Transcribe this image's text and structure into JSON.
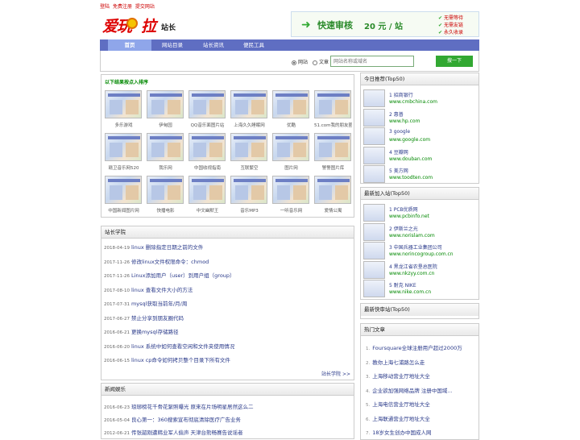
{
  "topbar": {
    "login": "登陆",
    "register": "免费注册",
    "submit": "提交网站"
  },
  "logo": {
    "main": "爱玩",
    "main2": "拉",
    "suffix": "站长"
  },
  "ad": {
    "title": "快速审核",
    "price": "20 元 / 站",
    "features": [
      "无需等待",
      "无需友链",
      "永久收录"
    ]
  },
  "nav": {
    "items": [
      "首页",
      "网站目录",
      "站长资讯",
      "便民工具"
    ]
  },
  "search": {
    "option1": "网站",
    "option2": "文章",
    "placeholder": "网站名称或域名",
    "button": "搜一下"
  },
  "sites": {
    "heading": "以下结果按点入排序",
    "items": [
      "多乐游戏",
      "伊甸园",
      "QQ音乐面图片站",
      "上海久久睡眠网",
      "优酷",
      "51.com我的朋友圈",
      "赣卫音乐网520",
      "我乐网",
      "中国收视指南",
      "互联繁空",
      "图片网",
      "警警图片库",
      "中国新闻图片网",
      "快播电影",
      "中文幽默王",
      "音乐MP3",
      "一听音乐网",
      "爱情公寓"
    ]
  },
  "academy": {
    "title": "站长学院",
    "more": "站长学院 >>",
    "articles": [
      {
        "date": "2018-04-19",
        "title": "linux 删除指定日期之前的文件"
      },
      {
        "date": "2017-11-26",
        "title": "修改linux文件权限命令：chmod"
      },
      {
        "date": "2017-11-26",
        "title": "Linux添加用户（user）到用户组（group）"
      },
      {
        "date": "2017-08-10",
        "title": "linux 查看文件大小的方法"
      },
      {
        "date": "2017-07-31",
        "title": "mysql获取当前年/月/周"
      },
      {
        "date": "2017-06-27",
        "title": "禁止分享到朋友圈代码"
      },
      {
        "date": "2016-06-21",
        "title": "更换mysql存储路径"
      },
      {
        "date": "2016-06-20",
        "title": "linux 系统中如何查看空闲和文件夹使用情况"
      },
      {
        "date": "2016-06-15",
        "title": "linux cp命令如何拷贝整个目录下所有文件"
      }
    ]
  },
  "news": {
    "title": "新闻娱乐",
    "articles": [
      {
        "date": "2016-06-23",
        "title": "琅琊榜花千骨花絮照曝光 原来在片场明星居然这么二"
      },
      {
        "date": "2016-05-04",
        "title": "良心第一：360搜索宣布彻底清除医疗广告业务"
      },
      {
        "date": "2012-06-21",
        "title": "传张韶刚遭韩业军人偷声 天津台熊畅赛告说谣者"
      }
    ]
  },
  "today": {
    "title": "今日推荐(Top50)",
    "items": [
      {
        "name": "1 招商银行",
        "url": "www.cmbchina.com"
      },
      {
        "name": "2 惠普",
        "url": "www.hp.com"
      },
      {
        "name": "3 google",
        "url": "www.google.com"
      },
      {
        "name": "4 豆瓣网",
        "url": "www.douban.com"
      },
      {
        "name": "5 美方网",
        "url": "www.toodten.com"
      }
    ]
  },
  "latest": {
    "title": "最新加入站(Top50)",
    "items": [
      {
        "name": "1 PCB优质网",
        "url": "www.pcbinfo.net"
      },
      {
        "name": "2 伊斯兰之光",
        "url": "www.norislam.com"
      },
      {
        "name": "3 中国兵器工业集团公司",
        "url": "www.norincogroup.com.cn"
      },
      {
        "name": "4 黑龙江省农垦总医院",
        "url": "www.nkzyy.com.cn"
      },
      {
        "name": "5 耐克 NIKE",
        "url": "www.nike.com.cn"
      }
    ]
  },
  "fast": {
    "title": "最新快审站(Top50)"
  },
  "hot": {
    "title": "热门文章",
    "items": [
      {
        "n": "1.",
        "t": "Foursquare全球注册用户超过2000万"
      },
      {
        "n": "2.",
        "t": "教你上海七浦路怎么走"
      },
      {
        "n": "3.",
        "t": "上海移动营业厅地址大全"
      },
      {
        "n": "4.",
        "t": "企业欲加强网络品牌 注册中国域..."
      },
      {
        "n": "5.",
        "t": "上海电信营业厅地址大全"
      },
      {
        "n": "6.",
        "t": "上海联通营业厅地址大全"
      },
      {
        "n": "7.",
        "t": "18岁女生创办中国成人网"
      }
    ]
  }
}
